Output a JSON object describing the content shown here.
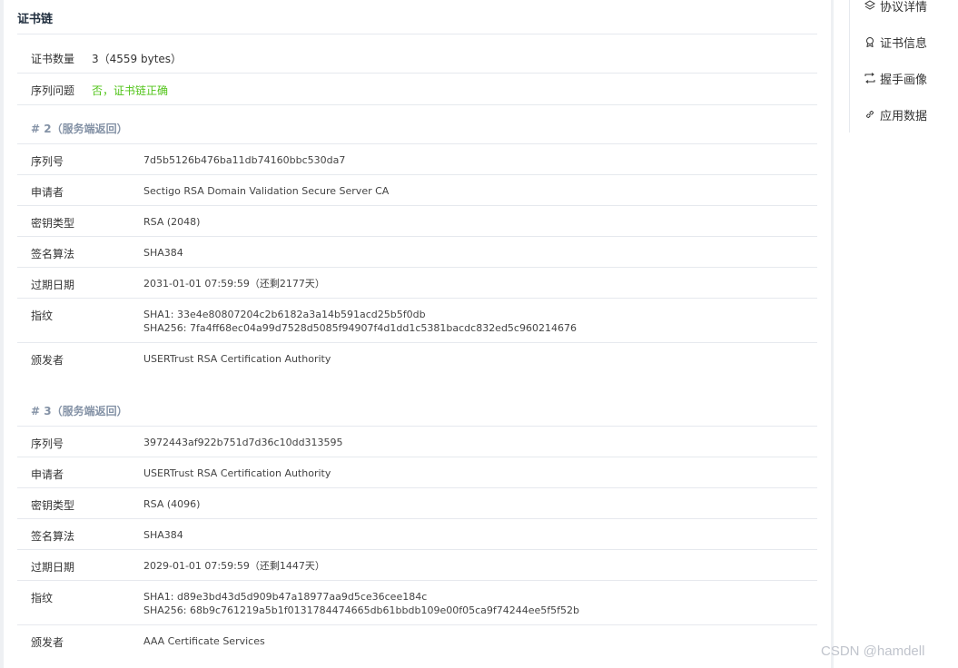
{
  "section_title": "证书链",
  "summary": [
    {
      "label": "证书数量",
      "value": "3（4559 bytes）"
    },
    {
      "label": "序列问题",
      "value": "否，证书链正确"
    }
  ],
  "certs": [
    {
      "heading": "# 2（服务端返回）",
      "rows": [
        {
          "label": "序列号",
          "value": "7d5b5126b476ba11db74160bbc530da7"
        },
        {
          "label": "申请者",
          "value": "Sectigo RSA Domain Validation Secure Server CA"
        },
        {
          "label": "密钥类型",
          "value": "RSA (2048)"
        },
        {
          "label": "签名算法",
          "value": "SHA384"
        },
        {
          "label": "过期日期",
          "value": "2031-01-01 07:59:59（还剩2177天）"
        },
        {
          "label": "指纹",
          "value": "SHA1: 33e4e80807204c2b6182a3a14b591acd25b5f0db",
          "value2": "SHA256: 7fa4ff68ec04a99d7528d5085f94907f4d1dd1c5381bacdc832ed5c960214676"
        },
        {
          "label": "颁发者",
          "value": "USERTrust RSA Certification Authority"
        }
      ]
    },
    {
      "heading": "# 3（服务端返回）",
      "rows": [
        {
          "label": "序列号",
          "value": "3972443af922b751d7d36c10dd313595"
        },
        {
          "label": "申请者",
          "value": "USERTrust RSA Certification Authority"
        },
        {
          "label": "密钥类型",
          "value": "RSA (4096)"
        },
        {
          "label": "签名算法",
          "value": "SHA384"
        },
        {
          "label": "过期日期",
          "value": "2029-01-01 07:59:59（还剩1447天）"
        },
        {
          "label": "指纹",
          "value": "SHA1: d89e3bd43d5d909b47a18977aa9d5ce36cee184c",
          "value2": "SHA256: 68b9c761219a5b1f0131784474665db61bbdb109e00f05ca9f74244ee5f5f52b"
        },
        {
          "label": "颁发者",
          "value": "AAA Certificate Services"
        }
      ]
    }
  ],
  "side_nav": [
    {
      "label": "协议详情",
      "icon": "layers-icon"
    },
    {
      "label": "证书信息",
      "icon": "badge-icon"
    },
    {
      "label": "握手画像",
      "icon": "exchange-icon"
    },
    {
      "label": "应用数据",
      "icon": "link-icon"
    }
  ],
  "watermark": "CSDN @hamdell",
  "colors": {
    "accent_ok": "#52c41a",
    "muted_heading": "#8492a6",
    "border": "#e6e9ee"
  }
}
